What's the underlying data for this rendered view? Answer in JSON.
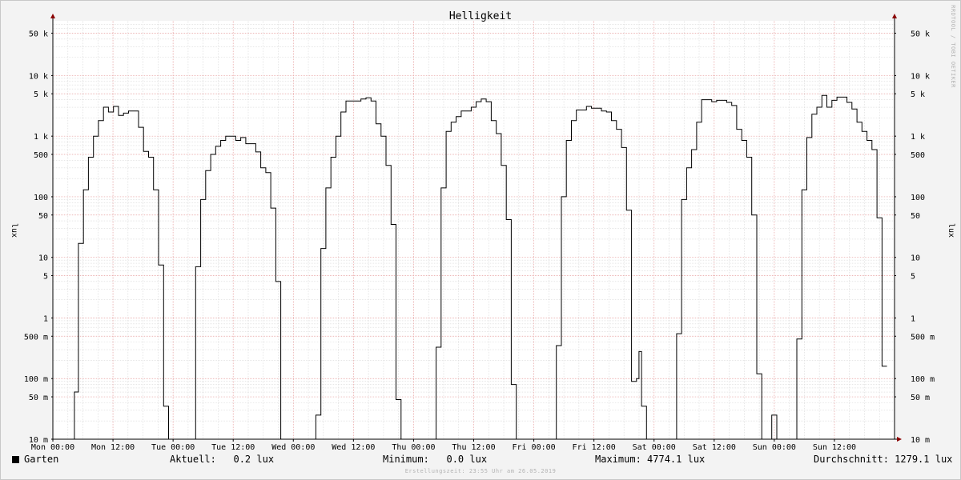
{
  "chart_data": {
    "type": "line",
    "title": "Helligkeit",
    "ylabel": "lux",
    "yscale": "log",
    "ylim": [
      0.01,
      80000
    ],
    "xlim": [
      0,
      168
    ],
    "grid": true,
    "y_ticks": [
      {
        "value": 0.01,
        "label": "10 m"
      },
      {
        "value": 0.05,
        "label": "50 m"
      },
      {
        "value": 0.1,
        "label": "100 m"
      },
      {
        "value": 0.5,
        "label": "500 m"
      },
      {
        "value": 1,
        "label": "1"
      },
      {
        "value": 5,
        "label": "5"
      },
      {
        "value": 10,
        "label": "10"
      },
      {
        "value": 50,
        "label": "50"
      },
      {
        "value": 100,
        "label": "100"
      },
      {
        "value": 500,
        "label": "500"
      },
      {
        "value": 1000,
        "label": "1 k"
      },
      {
        "value": 5000,
        "label": "5 k"
      },
      {
        "value": 10000,
        "label": "10 k"
      },
      {
        "value": 50000,
        "label": "50 k"
      }
    ],
    "x_ticks": [
      {
        "value": 0,
        "label": "Mon 00:00"
      },
      {
        "value": 12,
        "label": "Mon 12:00"
      },
      {
        "value": 24,
        "label": "Tue 00:00"
      },
      {
        "value": 36,
        "label": "Tue 12:00"
      },
      {
        "value": 48,
        "label": "Wed 00:00"
      },
      {
        "value": 60,
        "label": "Wed 12:00"
      },
      {
        "value": 72,
        "label": "Thu 00:00"
      },
      {
        "value": 84,
        "label": "Thu 12:00"
      },
      {
        "value": 96,
        "label": "Fri 00:00"
      },
      {
        "value": 108,
        "label": "Fri 12:00"
      },
      {
        "value": 120,
        "label": "Sat 00:00"
      },
      {
        "value": 132,
        "label": "Sat 12:00"
      },
      {
        "value": 144,
        "label": "Sun 00:00"
      },
      {
        "value": 156,
        "label": "Sun 12:00"
      }
    ],
    "series": [
      {
        "name": "Garten",
        "color": "#000000",
        "step": true,
        "points": [
          [
            0,
            0.01
          ],
          [
            4.3,
            0.01
          ],
          [
            4.3,
            0.06
          ],
          [
            5.1,
            0.06
          ],
          [
            5.1,
            17
          ],
          [
            6.1,
            17
          ],
          [
            6.1,
            130
          ],
          [
            7.1,
            130
          ],
          [
            7.1,
            450
          ],
          [
            8.1,
            450
          ],
          [
            8.1,
            1000
          ],
          [
            9.1,
            1000
          ],
          [
            9.1,
            1800
          ],
          [
            10.1,
            1800
          ],
          [
            10.1,
            3000
          ],
          [
            11.1,
            3000
          ],
          [
            11.1,
            2500
          ],
          [
            12.1,
            2500
          ],
          [
            12.1,
            3100
          ],
          [
            13.1,
            3100
          ],
          [
            13.1,
            2200
          ],
          [
            14.1,
            2200
          ],
          [
            14.1,
            2400
          ],
          [
            15.1,
            2400
          ],
          [
            15.1,
            2600
          ],
          [
            17.1,
            2600
          ],
          [
            17.1,
            1400
          ],
          [
            18.1,
            1400
          ],
          [
            18.1,
            560
          ],
          [
            19.1,
            560
          ],
          [
            19.1,
            450
          ],
          [
            20.1,
            450
          ],
          [
            20.1,
            130
          ],
          [
            21.1,
            130
          ],
          [
            21.1,
            7.5
          ],
          [
            22.1,
            7.5
          ],
          [
            22.1,
            0.035
          ],
          [
            23.1,
            0.035
          ],
          [
            23.1,
            0.01
          ],
          [
            28.5,
            0.01
          ],
          [
            28.5,
            7
          ],
          [
            29.5,
            7
          ],
          [
            29.5,
            90
          ],
          [
            30.5,
            90
          ],
          [
            30.5,
            270
          ],
          [
            31.5,
            270
          ],
          [
            31.5,
            500
          ],
          [
            32.5,
            500
          ],
          [
            32.5,
            680
          ],
          [
            33.5,
            680
          ],
          [
            33.5,
            850
          ],
          [
            34.5,
            850
          ],
          [
            34.5,
            1000
          ],
          [
            36.5,
            1000
          ],
          [
            36.5,
            850
          ],
          [
            37.5,
            850
          ],
          [
            37.5,
            950
          ],
          [
            38.5,
            950
          ],
          [
            38.5,
            750
          ],
          [
            40.5,
            750
          ],
          [
            40.5,
            550
          ],
          [
            41.5,
            550
          ],
          [
            41.5,
            300
          ],
          [
            42.5,
            300
          ],
          [
            42.5,
            250
          ],
          [
            43.5,
            250
          ],
          [
            43.5,
            65
          ],
          [
            44.5,
            65
          ],
          [
            44.5,
            4
          ],
          [
            45.5,
            4
          ],
          [
            45.5,
            0.01
          ],
          [
            52.5,
            0.01
          ],
          [
            52.5,
            0.025
          ],
          [
            53.5,
            0.025
          ],
          [
            53.5,
            14
          ],
          [
            54.5,
            14
          ],
          [
            54.5,
            140
          ],
          [
            55.5,
            140
          ],
          [
            55.5,
            450
          ],
          [
            56.5,
            450
          ],
          [
            56.5,
            1000
          ],
          [
            57.5,
            1000
          ],
          [
            57.5,
            2500
          ],
          [
            58.5,
            2500
          ],
          [
            58.5,
            3800
          ],
          [
            61.5,
            3800
          ],
          [
            61.5,
            4100
          ],
          [
            62.5,
            4100
          ],
          [
            62.5,
            4300
          ],
          [
            63.5,
            4300
          ],
          [
            63.5,
            3800
          ],
          [
            64.5,
            3800
          ],
          [
            64.5,
            1600
          ],
          [
            65.5,
            1600
          ],
          [
            65.5,
            1000
          ],
          [
            66.5,
            1000
          ],
          [
            66.5,
            330
          ],
          [
            67.5,
            330
          ],
          [
            67.5,
            35
          ],
          [
            68.5,
            35
          ],
          [
            68.5,
            0.045
          ],
          [
            69.5,
            0.045
          ],
          [
            69.5,
            0.01
          ],
          [
            76.5,
            0.01
          ],
          [
            76.5,
            0.33
          ],
          [
            77.5,
            0.33
          ],
          [
            77.5,
            140
          ],
          [
            78.5,
            140
          ],
          [
            78.5,
            1200
          ],
          [
            79.5,
            1200
          ],
          [
            79.5,
            1700
          ],
          [
            80.5,
            1700
          ],
          [
            80.5,
            2100
          ],
          [
            81.5,
            2100
          ],
          [
            81.5,
            2600
          ],
          [
            83.5,
            2600
          ],
          [
            83.5,
            3000
          ],
          [
            84.5,
            3000
          ],
          [
            84.5,
            3700
          ],
          [
            85.5,
            3700
          ],
          [
            85.5,
            4100
          ],
          [
            86.5,
            4100
          ],
          [
            86.5,
            3700
          ],
          [
            87.5,
            3700
          ],
          [
            87.5,
            1800
          ],
          [
            88.5,
            1800
          ],
          [
            88.5,
            1100
          ],
          [
            89.5,
            1100
          ],
          [
            89.5,
            330
          ],
          [
            90.5,
            330
          ],
          [
            90.5,
            42
          ],
          [
            91.5,
            42
          ],
          [
            91.5,
            0.08
          ],
          [
            92.5,
            0.08
          ],
          [
            92.5,
            0.01
          ],
          [
            100.5,
            0.01
          ],
          [
            100.5,
            0.35
          ],
          [
            101.5,
            0.35
          ],
          [
            101.5,
            100
          ],
          [
            102.5,
            100
          ],
          [
            102.5,
            850
          ],
          [
            103.5,
            850
          ],
          [
            103.5,
            1800
          ],
          [
            104.5,
            1800
          ],
          [
            104.5,
            2700
          ],
          [
            106.5,
            2700
          ],
          [
            106.5,
            3100
          ],
          [
            107.5,
            3100
          ],
          [
            107.5,
            2900
          ],
          [
            109.5,
            2900
          ],
          [
            109.5,
            2600
          ],
          [
            110.5,
            2600
          ],
          [
            110.5,
            2500
          ],
          [
            111.5,
            2500
          ],
          [
            111.5,
            1800
          ],
          [
            112.5,
            1800
          ],
          [
            112.5,
            1300
          ],
          [
            113.5,
            1300
          ],
          [
            113.5,
            650
          ],
          [
            114.5,
            650
          ],
          [
            114.5,
            60
          ],
          [
            115.5,
            60
          ],
          [
            115.5,
            0.09
          ],
          [
            116.5,
            0.09
          ],
          [
            116.5,
            0.1
          ],
          [
            117,
            0.1
          ],
          [
            117,
            0.28
          ],
          [
            117.5,
            0.28
          ],
          [
            117.5,
            0.035
          ],
          [
            118.5,
            0.035
          ],
          [
            118.5,
            0.01
          ],
          [
            124.5,
            0.01
          ],
          [
            124.5,
            0.55
          ],
          [
            125.5,
            0.55
          ],
          [
            125.5,
            90
          ],
          [
            126.5,
            90
          ],
          [
            126.5,
            300
          ],
          [
            127.5,
            300
          ],
          [
            127.5,
            600
          ],
          [
            128.5,
            600
          ],
          [
            128.5,
            1700
          ],
          [
            129.5,
            1700
          ],
          [
            129.5,
            4000
          ],
          [
            131.5,
            4000
          ],
          [
            131.5,
            3700
          ],
          [
            132.5,
            3700
          ],
          [
            132.5,
            3900
          ],
          [
            134.5,
            3900
          ],
          [
            134.5,
            3600
          ],
          [
            135.5,
            3600
          ],
          [
            135.5,
            3200
          ],
          [
            136.5,
            3200
          ],
          [
            136.5,
            1300
          ],
          [
            137.5,
            1300
          ],
          [
            137.5,
            850
          ],
          [
            138.5,
            850
          ],
          [
            138.5,
            450
          ],
          [
            139.5,
            450
          ],
          [
            139.5,
            50
          ],
          [
            140.5,
            50
          ],
          [
            140.5,
            0.12
          ],
          [
            141.5,
            0.12
          ],
          [
            141.5,
            0.01
          ],
          [
            143.5,
            0.01
          ],
          [
            143.5,
            0.025
          ],
          [
            144.5,
            0.025
          ],
          [
            144.5,
            0.01
          ],
          [
            148.5,
            0.01
          ],
          [
            148.5,
            0.45
          ],
          [
            149.5,
            0.45
          ],
          [
            149.5,
            130
          ],
          [
            150.5,
            130
          ],
          [
            150.5,
            950
          ],
          [
            151.5,
            950
          ],
          [
            151.5,
            2300
          ],
          [
            152.5,
            2300
          ],
          [
            152.5,
            3000
          ],
          [
            153.5,
            3000
          ],
          [
            153.5,
            4700
          ],
          [
            154.5,
            4700
          ],
          [
            154.5,
            3000
          ],
          [
            155.5,
            3000
          ],
          [
            155.5,
            3900
          ],
          [
            156.5,
            3900
          ],
          [
            156.5,
            4400
          ],
          [
            158.5,
            4400
          ],
          [
            158.5,
            3600
          ],
          [
            159.5,
            3600
          ],
          [
            159.5,
            2800
          ],
          [
            160.5,
            2800
          ],
          [
            160.5,
            1700
          ],
          [
            161.5,
            1700
          ],
          [
            161.5,
            1200
          ],
          [
            162.5,
            1200
          ],
          [
            162.5,
            850
          ],
          [
            163.5,
            850
          ],
          [
            163.5,
            600
          ],
          [
            164.5,
            600
          ],
          [
            164.5,
            45
          ],
          [
            165.5,
            45
          ],
          [
            165.5,
            0.16
          ],
          [
            166.5,
            0.16
          ]
        ]
      }
    ],
    "legend": {
      "position": "bottom-left",
      "label": "Garten",
      "stats": {
        "current": "Aktuell:   0.2 lux",
        "minimum": "Minimum:   0.0 lux",
        "maximum": "Maximum: 4774.1 lux",
        "average": "Durchschnitt: 1279.1 lux"
      }
    },
    "side_credit": "RRDTOOL / TOBI OETIKER",
    "footer": "Erstellungszeit: 23:55 Uhr am 26.05.2019"
  },
  "colors": {
    "background": "#f3f3f3",
    "plot_area": "#ffffff",
    "minor_grid": "#d9d9d9",
    "major_grid": "#e7a0a0",
    "axis": "#000000",
    "arrow": "#8b0000",
    "line": "#000000"
  }
}
